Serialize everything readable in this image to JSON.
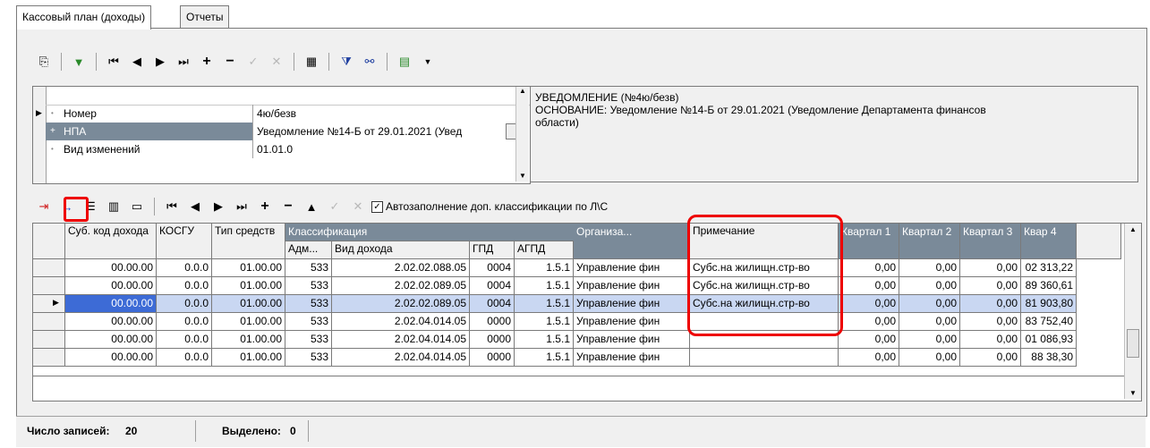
{
  "tabs": [
    {
      "label": "Кассовый план (доходы)"
    },
    {
      "label": "Отчеты"
    }
  ],
  "properties": [
    {
      "name": "Номер",
      "value": "4ю/безв"
    },
    {
      "name": "НПА",
      "value": "Уведомление №14-Б от 29.01.2021 (Увед"
    },
    {
      "name": "Вид изменений",
      "value": "01.01.0"
    }
  ],
  "notice": {
    "line1": "УВЕДОМЛЕНИЕ  (№4ю/безв)",
    "line2": "ОСНОВАНИЕ: Уведомление №14-Б от 29.01.2021 (Уведомление Департамента финансов",
    "line3": "области)"
  },
  "autofill_label": "Автозаполнение доп. классификации по Л\\С",
  "grid": {
    "headers": {
      "sub_code": "Суб. код дохода",
      "kosgu": "КОСГУ",
      "fund_type": "Тип средств",
      "classification": "Классификация",
      "adm": "Адм...",
      "income_type": "Вид дохода",
      "gpd": "ГПД",
      "agpd": "АГПД",
      "org": "Организа...",
      "note": "Примечание",
      "q1": "Квартал 1",
      "q2": "Квартал 2",
      "q3": "Квартал 3",
      "q4": "Квар 4"
    },
    "rows": [
      {
        "sub_code": "00.00.00",
        "kosgu": "0.0.0",
        "fund_type": "01.00.00",
        "adm": "533",
        "income_type": "2.02.02.088.05",
        "gpd": "0004",
        "agpd": "1.5.1",
        "org": "Управление фин",
        "note": "Субс.на жилищн.стр-во",
        "q1": "0,00",
        "q2": "0,00",
        "q3": "0,00",
        "q4": "02 313,22"
      },
      {
        "sub_code": "00.00.00",
        "kosgu": "0.0.0",
        "fund_type": "01.00.00",
        "adm": "533",
        "income_type": "2.02.02.089.05",
        "gpd": "0004",
        "agpd": "1.5.1",
        "org": "Управление фин",
        "note": "Субс.на жилищн.стр-во",
        "q1": "0,00",
        "q2": "0,00",
        "q3": "0,00",
        "q4": "89 360,61"
      },
      {
        "sub_code": "00.00.00",
        "kosgu": "0.0.0",
        "fund_type": "01.00.00",
        "adm": "533",
        "income_type": "2.02.02.089.05",
        "gpd": "0004",
        "agpd": "1.5.1",
        "org": "Управление фин",
        "note": "Субс.на жилищн.стр-во",
        "q1": "0,00",
        "q2": "0,00",
        "q3": "0,00",
        "q4": "81 903,80"
      },
      {
        "sub_code": "00.00.00",
        "kosgu": "0.0.0",
        "fund_type": "01.00.00",
        "adm": "533",
        "income_type": "2.02.04.014.05",
        "gpd": "0000",
        "agpd": "1.5.1",
        "org": "Управление фин",
        "note": "",
        "q1": "0,00",
        "q2": "0,00",
        "q3": "0,00",
        "q4": "83 752,40"
      },
      {
        "sub_code": "00.00.00",
        "kosgu": "0.0.0",
        "fund_type": "01.00.00",
        "adm": "533",
        "income_type": "2.02.04.014.05",
        "gpd": "0000",
        "agpd": "1.5.1",
        "org": "Управление фин",
        "note": "",
        "q1": "0,00",
        "q2": "0,00",
        "q3": "0,00",
        "q4": "01 086,93"
      },
      {
        "sub_code": "00.00.00",
        "kosgu": "0.0.0",
        "fund_type": "01.00.00",
        "adm": "533",
        "income_type": "2.02.04.014.05",
        "gpd": "0000",
        "agpd": "1.5.1",
        "org": "Управление фин",
        "note": "",
        "q1": "0,00",
        "q2": "0,00",
        "q3": "0,00",
        "q4": "88  38,30"
      }
    ]
  },
  "status": {
    "count_label": "Число записей:",
    "count_value": "20",
    "selected_label": "Выделено:",
    "selected_value": "0"
  },
  "colors": {
    "highlight": "#e00000",
    "selected_row": "#c9d7f2",
    "selected_cell": "#3d6bd6"
  }
}
